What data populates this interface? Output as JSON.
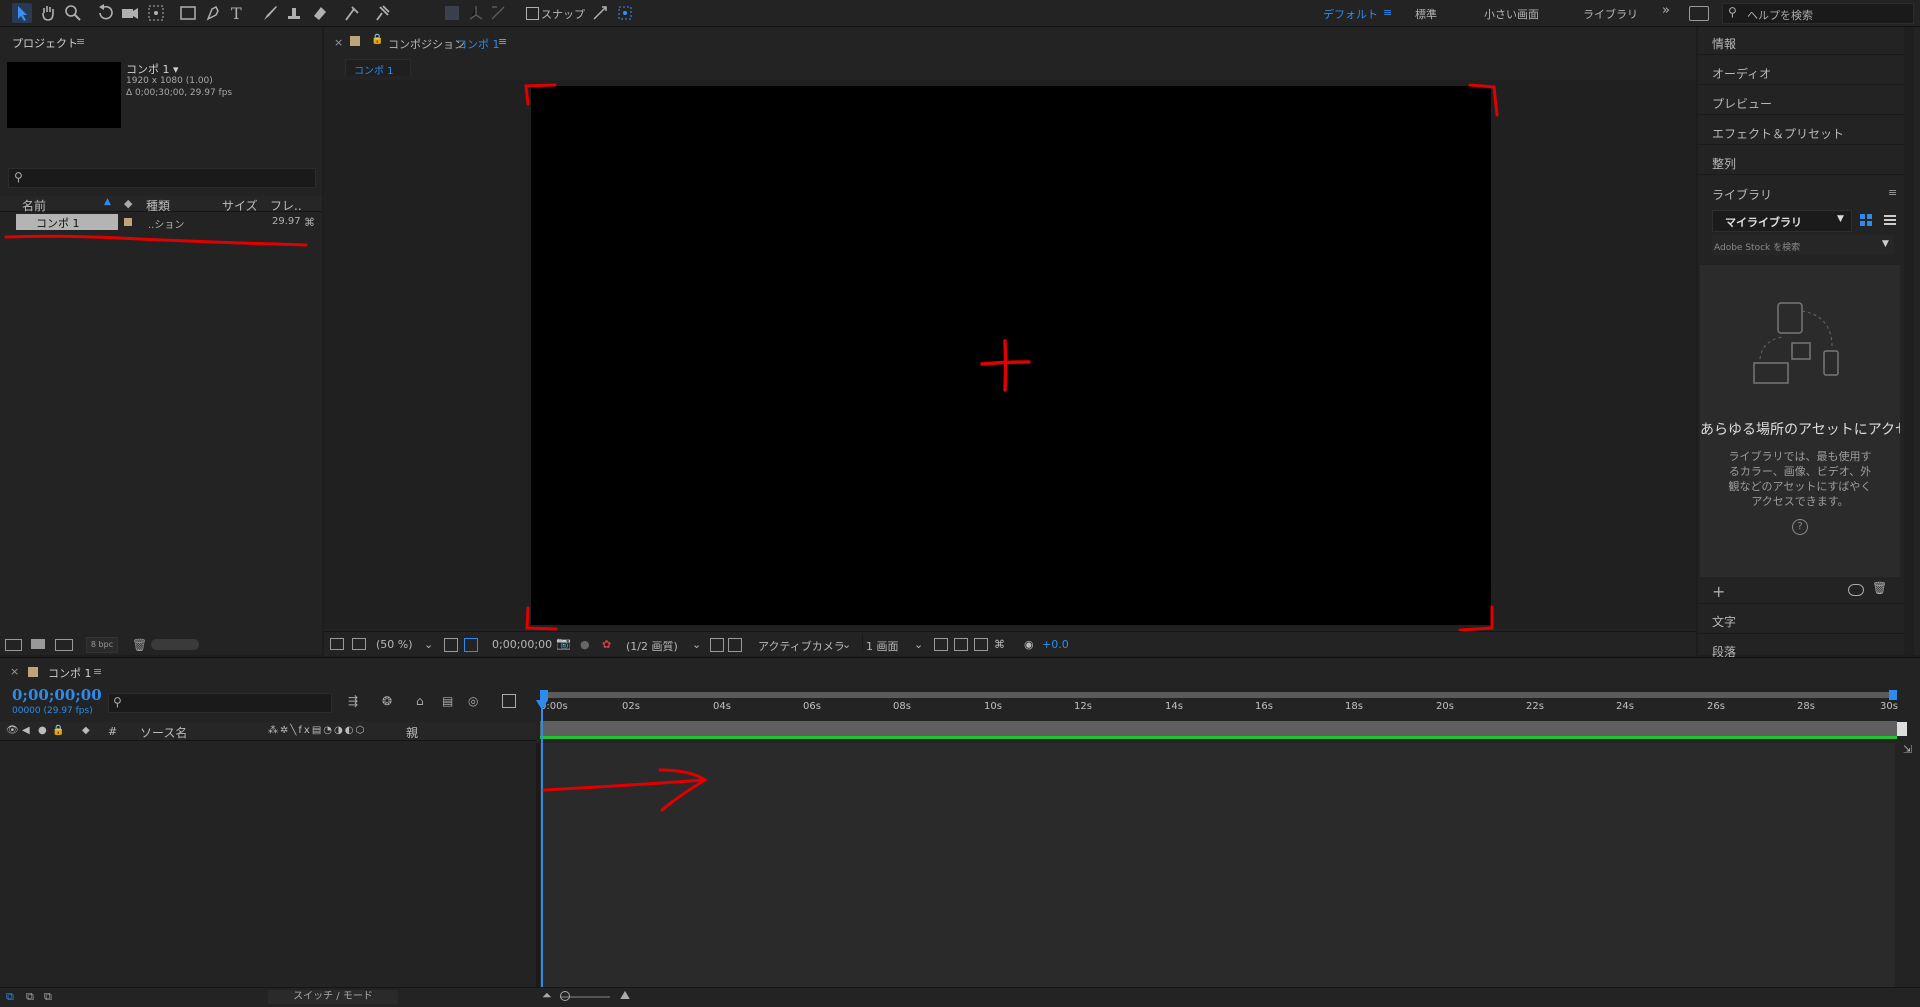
{
  "toolbar": {
    "snap_label": "スナップ",
    "workspaces": [
      "デフォルト",
      "標準",
      "小さい画面",
      "ライブラリ"
    ],
    "active_workspace": "デフォルト",
    "help_search_placeholder": "ヘルプを検索",
    "overflow_label": "»"
  },
  "project": {
    "title": "プロジェクト",
    "comp_name": "コンポ 1 ▾",
    "comp_size": "1920 x 1080 (1.00)",
    "comp_duration": "Δ 0;00;30;00, 29.97 fps",
    "columns": {
      "name": "名前",
      "type": "種類",
      "size": "サイズ",
      "frame": "フレ.."
    },
    "row": {
      "name": "コンポ 1",
      "type": "..ション",
      "fps": "29.97"
    },
    "bpc": "8 bpc"
  },
  "viewer": {
    "tab_prefix": "コンポジション",
    "tab_comp": "コンポ 1",
    "subtab": "コンポ 1",
    "zoom": "(50 %)",
    "timecode": "0;00;00;00",
    "resolution": "(1/2 画質)",
    "camera": "アクティブカメラ",
    "views": "1 画面",
    "exposure": "+0.0"
  },
  "right_panel": {
    "items_top": [
      "情報",
      "オーディオ",
      "プレビュー",
      "エフェクト＆プリセット",
      "整列"
    ],
    "library_title": "ライブラリ",
    "library_dropdown": "マイライブラリ",
    "stock_search": "Adobe Stock を検索",
    "empty_title": "あらゆる場所のアセットにアクセス",
    "empty_body_lines": [
      "ライブラリでは、最も使用す",
      "るカラー、画像、ビデオ、外",
      "観などのアセットにすばやく",
      "アクセスできます。"
    ],
    "items_bottom": [
      "文字",
      "段落"
    ]
  },
  "timeline": {
    "tab": "コンポ 1",
    "timecode": "0;00;00;00",
    "frame_info": "00000 (29.97 fps)",
    "col_source": "ソース名",
    "col_parent": "親",
    "col_hash": "#",
    "switch_mode": "スイッチ / モード",
    "ticks": [
      "0:00s",
      "02s",
      "04s",
      "06s",
      "08s",
      "10s",
      "12s",
      "14s",
      "16s",
      "18s",
      "20s",
      "22s",
      "24s",
      "26s",
      "28s",
      "30s"
    ]
  },
  "colors": {
    "accent_blue": "#2d8ceb",
    "annotation_red": "#e00000",
    "green_bar": "#22c42f"
  }
}
